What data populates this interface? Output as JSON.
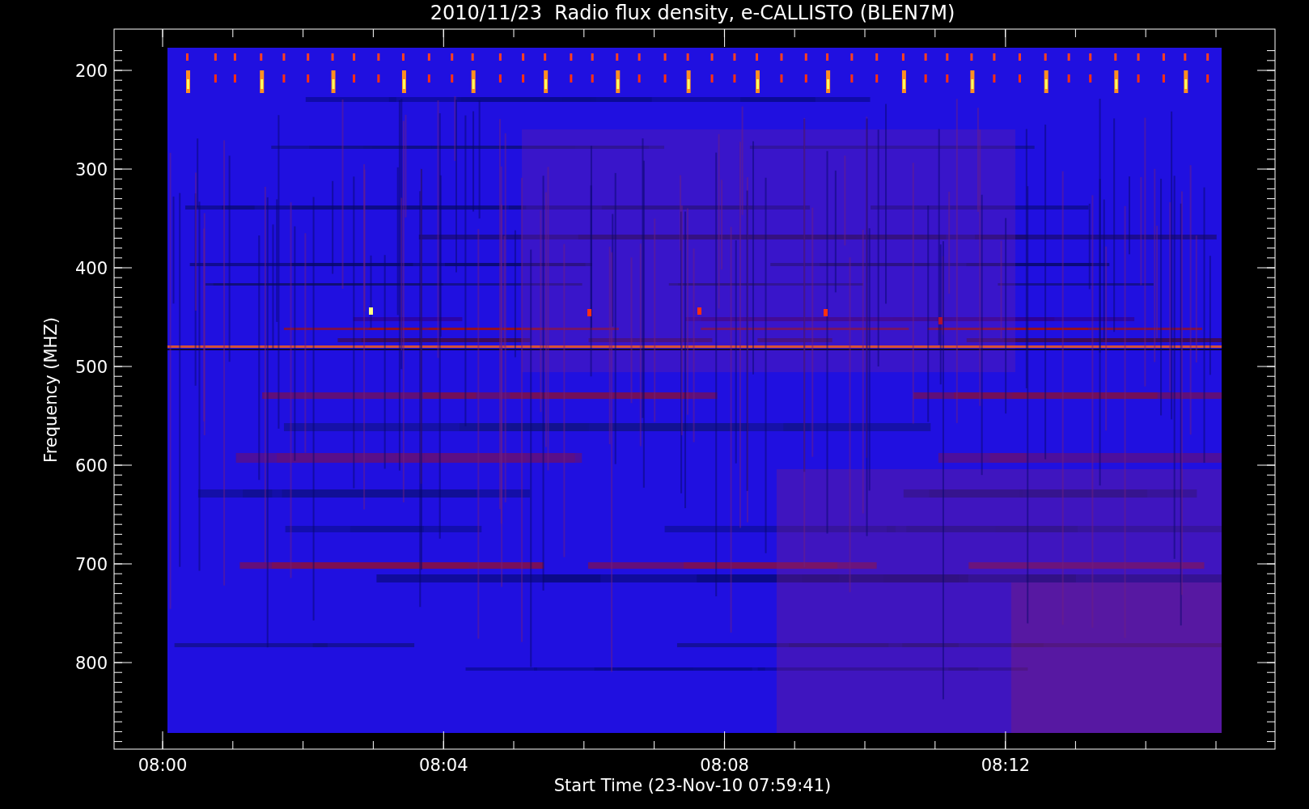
{
  "title": "2010/11/23  Radio flux density, e-CALLISTO (BLEN7M)",
  "y_axis": {
    "label": "Frequency (MHZ)",
    "ticks": [
      "200",
      "300",
      "400",
      "500",
      "600",
      "700",
      "800"
    ]
  },
  "x_axis": {
    "label": "Start Time (23-Nov-10 07:59:41)",
    "ticks": [
      "08:00",
      "08:04",
      "08:08",
      "08:12"
    ]
  }
}
